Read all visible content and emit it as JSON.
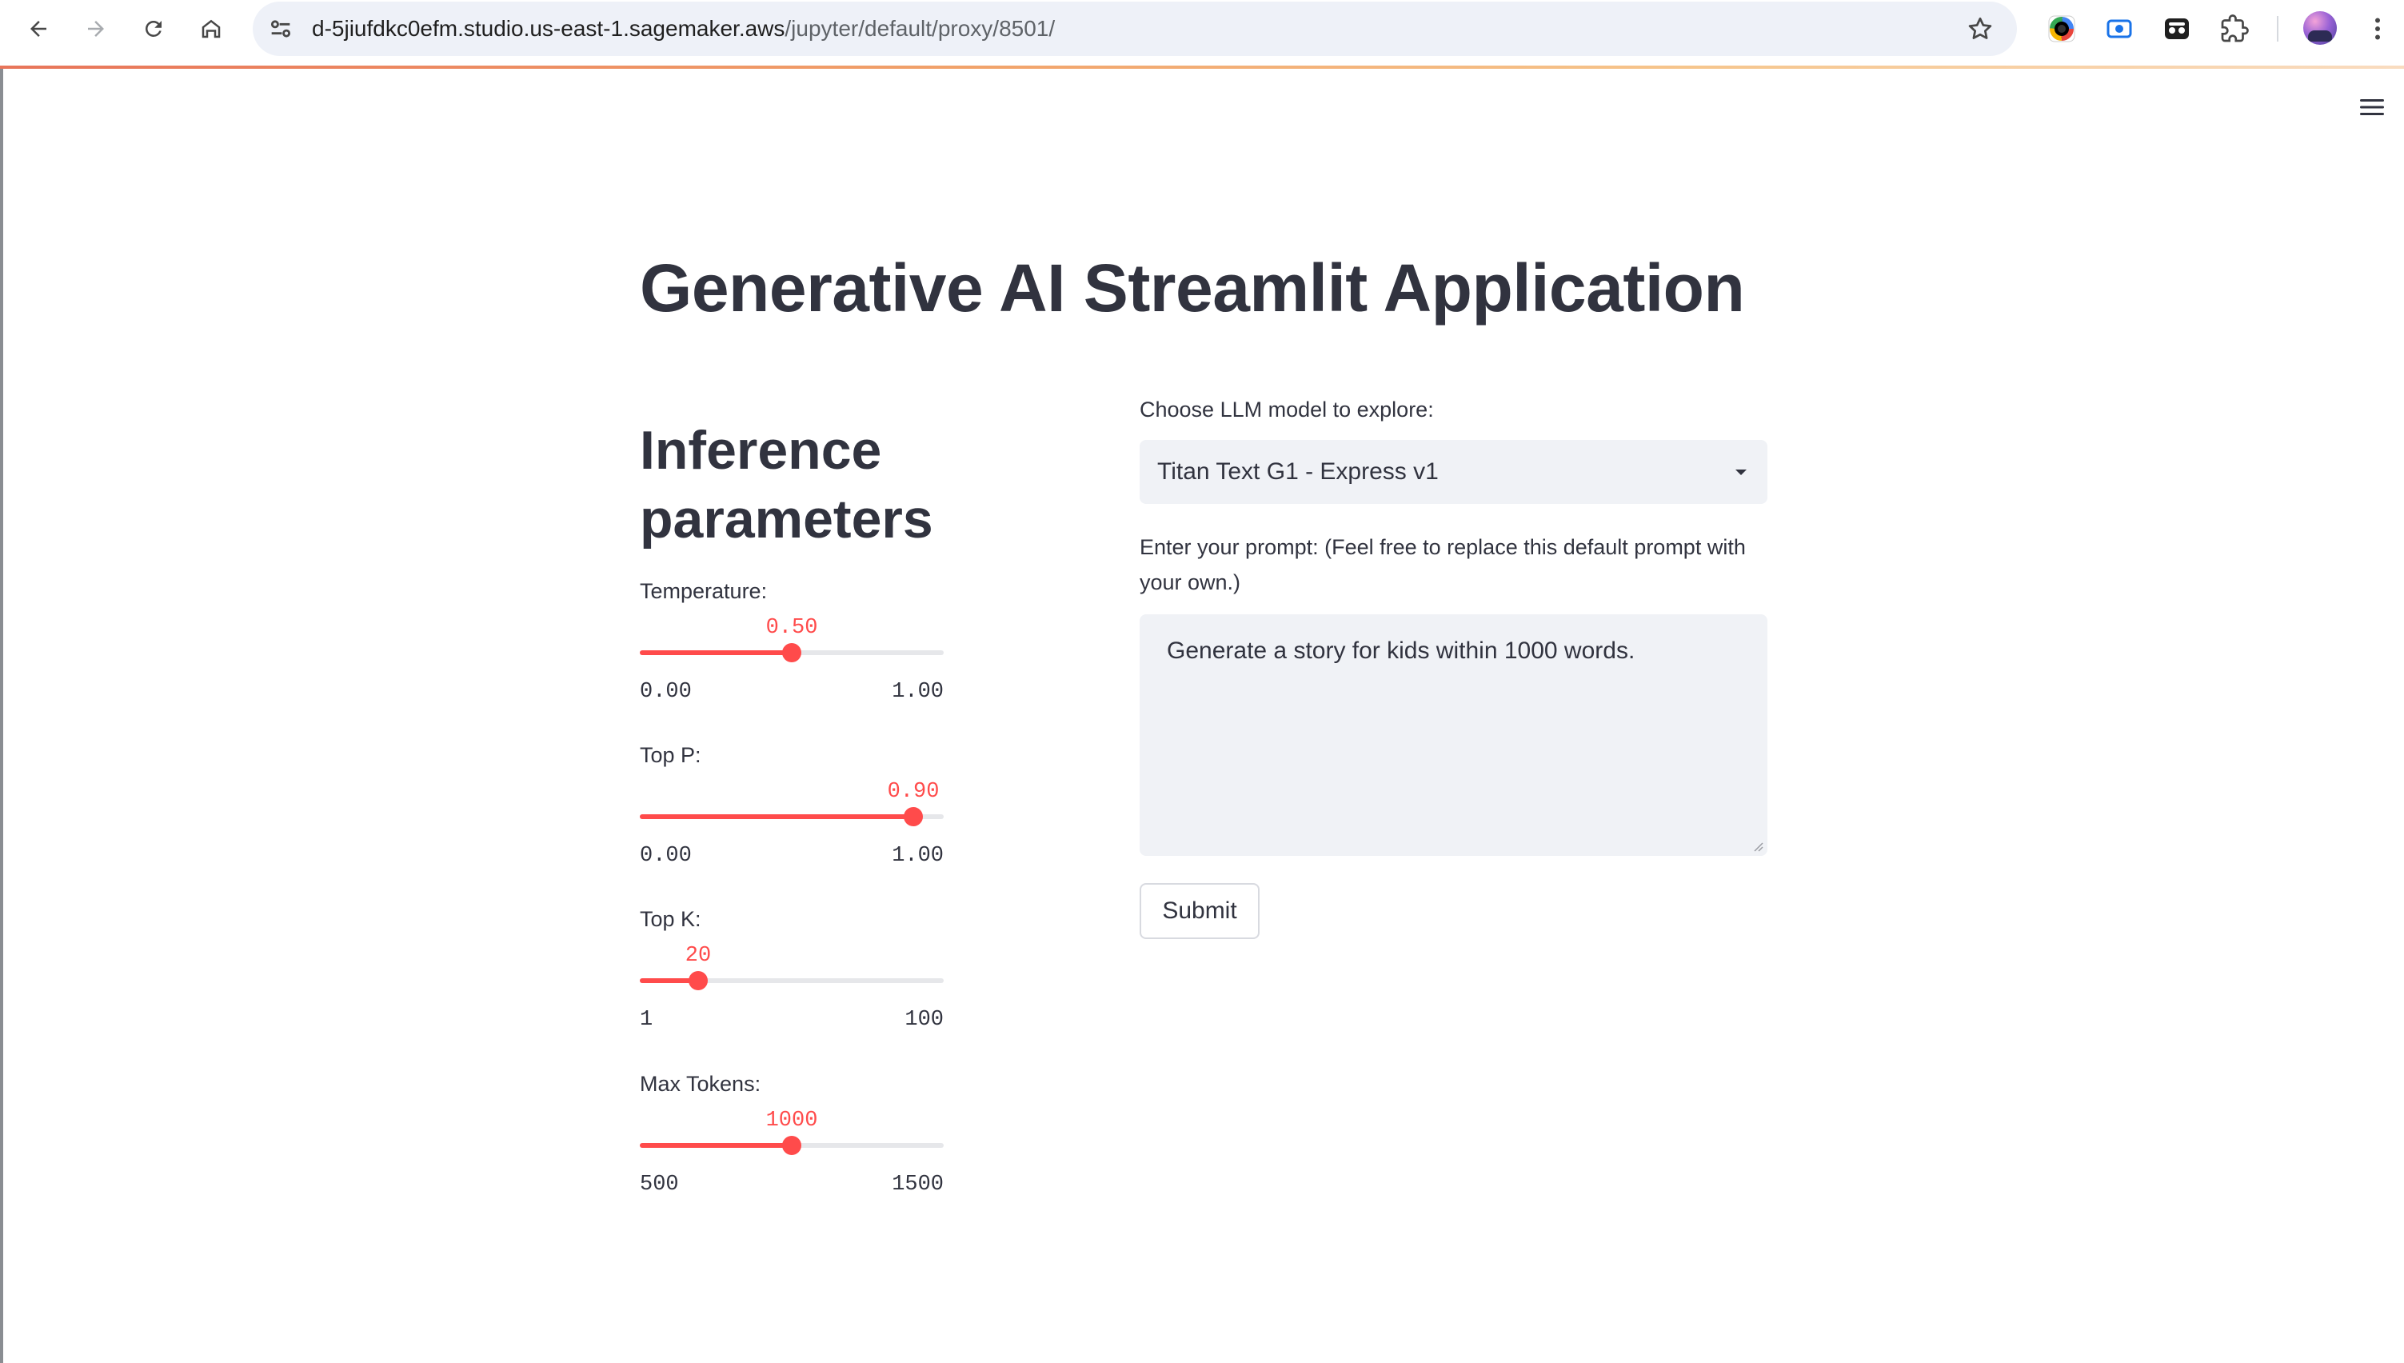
{
  "browser": {
    "url_host": "d-5jiufdkc0efm.studio.us-east-1.sagemaker.aws",
    "url_path": "/jupyter/default/proxy/8501/",
    "icons": {
      "back": "arrow-left-icon",
      "forward": "arrow-right-icon",
      "reload": "reload-icon",
      "home": "home-icon",
      "site_settings": "tune-icon",
      "bookmark": "star-icon",
      "menu": "kebab-menu-icon"
    },
    "extensions": [
      "color-picker-extension-icon",
      "screen-recorder-extension-icon",
      "incognito-extension-icon",
      "puzzle-extensions-icon"
    ]
  },
  "app": {
    "title": "Generative AI Streamlit Application",
    "menu_icon": "hamburger-menu-icon"
  },
  "inference": {
    "heading": "Inference parameters",
    "sliders": [
      {
        "label": "Temperature:",
        "value": "0.50",
        "min": "0.00",
        "max": "1.00",
        "fraction": 0.5
      },
      {
        "label": "Top P:",
        "value": "0.90",
        "min": "0.00",
        "max": "1.00",
        "fraction": 0.9
      },
      {
        "label": "Top K:",
        "value": "20",
        "min": "1",
        "max": "100",
        "fraction": 0.192
      },
      {
        "label": "Max Tokens:",
        "value": "1000",
        "min": "500",
        "max": "1500",
        "fraction": 0.5
      }
    ]
  },
  "model": {
    "label": "Choose LLM model to explore:",
    "selected": "Titan Text G1 - Express v1"
  },
  "prompt": {
    "label": "Enter your prompt: (Feel free to replace this default prompt with your own.)",
    "value": "Generate a story for kids within 1000 words."
  },
  "actions": {
    "submit_label": "Submit"
  },
  "colors": {
    "accent": "#ff4b4b",
    "text": "#31333f",
    "input_bg": "#f0f2f6"
  }
}
